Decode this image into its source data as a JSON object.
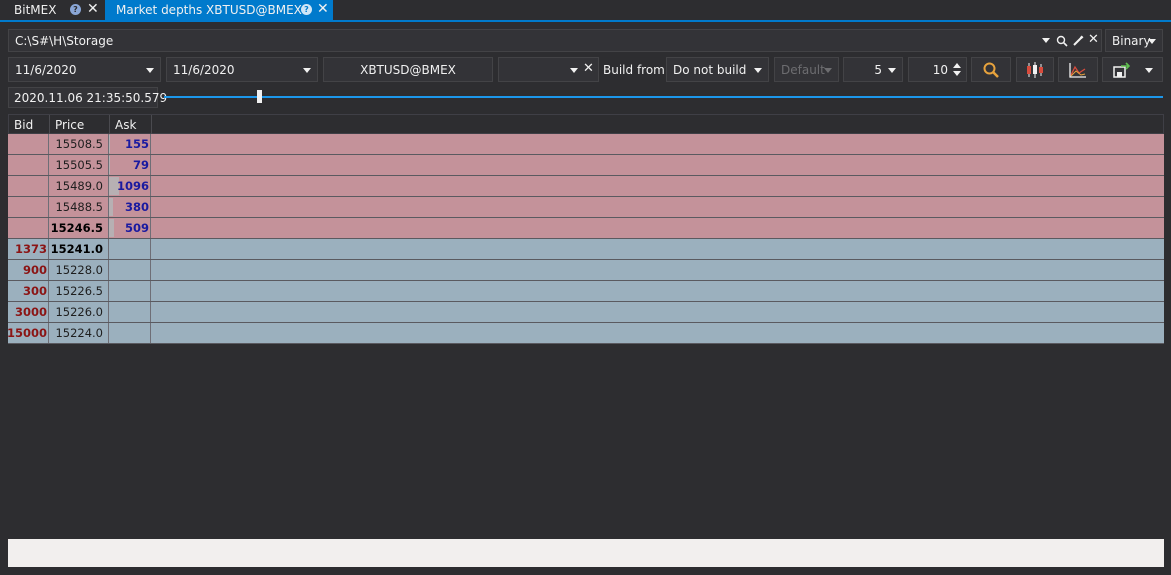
{
  "tabs": [
    {
      "label": "BitMEX"
    },
    {
      "label": "Market depths XBTUSD@BMEX"
    }
  ],
  "storage": {
    "path": "C:\\S#\\H\\Storage",
    "format": "Binary"
  },
  "toolbar": {
    "from_date": "11/6/2020",
    "to_date": "11/6/2020",
    "security": "XBTUSD@BMEX",
    "build_from_label": "Build from:",
    "build_from_value": "Do not build",
    "default_label": "Default",
    "depth": "5",
    "interval": "10"
  },
  "timestamp": "2020.11.06 21:35:50.579",
  "slider": {
    "position_fraction": 0.09
  },
  "grid": {
    "columns": [
      "Bid",
      "Price",
      "Ask"
    ],
    "asks": [
      {
        "price": "15508.5",
        "ask": "155",
        "bar": 0.14,
        "bold": false
      },
      {
        "price": "15505.5",
        "ask": "79",
        "bar": 0.07,
        "bold": false
      },
      {
        "price": "15489.0",
        "ask": "1096",
        "bar": 1.0,
        "bold": false
      },
      {
        "price": "15488.5",
        "ask": "380",
        "bar": 0.35,
        "bold": false
      },
      {
        "price": "15246.5",
        "ask": "509",
        "bar": 0.46,
        "bold": true
      }
    ],
    "bids": [
      {
        "bid": "1373",
        "price": "15241.0",
        "bold": true
      },
      {
        "bid": "900",
        "price": "15228.0",
        "bold": false
      },
      {
        "bid": "300",
        "price": "15226.5",
        "bold": false
      },
      {
        "bid": "3000",
        "price": "15226.0",
        "bold": false
      },
      {
        "bid": "15000",
        "price": "15224.0",
        "bold": false
      }
    ]
  },
  "colors": {
    "accent": "#007acc",
    "ask_row": "#c4929a",
    "bid_row": "#9bb0be",
    "ask_text": "#1a1aa0",
    "bid_text": "#8b1414",
    "search_icon": "#e8a33d"
  }
}
